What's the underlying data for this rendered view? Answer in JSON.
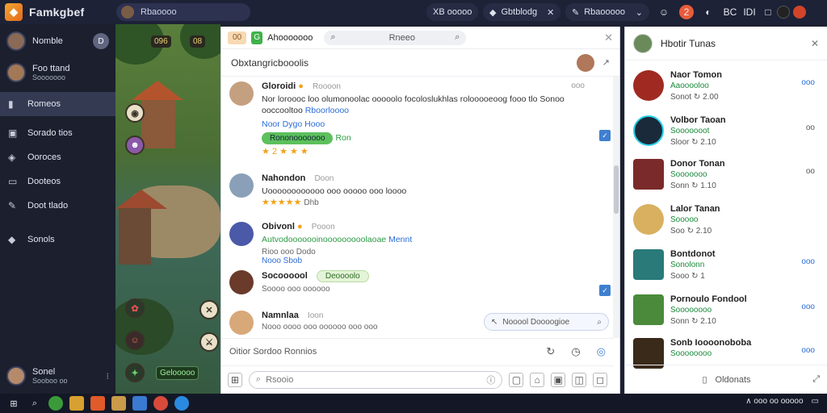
{
  "app": {
    "title": "Famkgbef",
    "logo_glyph": "◆"
  },
  "topbar": {
    "search_value": "Rbaoooo",
    "btn1": "XB ooooo",
    "btn2": "Gbtblodg",
    "btn3": "Rbaooooo",
    "icons": [
      "chat-icon",
      "notification-icon",
      "shield-icon",
      "friends-icon",
      "settings-icon"
    ],
    "notif_count": "2",
    "btn4": "BC",
    "btn5": "IDI"
  },
  "nav": {
    "profile": {
      "name": "Nomble",
      "badge": "D"
    },
    "account": {
      "name": "Foo ttand",
      "sub": "Sooooooo"
    },
    "items": [
      {
        "label": "Romeos",
        "icon": "home-icon",
        "selected": true
      },
      {
        "label": "Sorado tios",
        "icon": "grid-icon",
        "selected": false
      },
      {
        "label": "Ooroces",
        "icon": "tag-icon",
        "selected": false
      },
      {
        "label": "Dooteos",
        "icon": "folder-icon",
        "selected": false
      },
      {
        "label": "Doot tlado",
        "icon": "edit-icon",
        "selected": false
      },
      {
        "label": "Sonols",
        "icon": "diamond-icon",
        "selected": false
      }
    ],
    "user": {
      "name": "Sonel",
      "sub": "Sooboo oo"
    }
  },
  "game": {
    "hud_left": "096",
    "hud_right": "08",
    "bottom_label": "Gelooooo"
  },
  "chat": {
    "chip1": "00",
    "chip2": "G",
    "group_label": "Ahooooooo",
    "search_placeholder": "Rneeo",
    "title": "Obxtangricbooolis",
    "messages": [
      {
        "name": "Gloroidi",
        "time": "Roooon",
        "text": "Nor loroooc loo olumonoolac ooooolo focoloslukhlas rolooooeoog fooo tlo Sonoo ooccooltoo",
        "link": "Rboorloooo",
        "tag": "Noor Dygo Hooo",
        "pill": "Rononooooooo",
        "pill_note": "Ron",
        "stars": "★ 2 ★ ★ ★",
        "time_right": "ooo"
      },
      {
        "name": "Nahondon",
        "time": "Doon",
        "text": "Uoooooooooooo ooo ooooo ooo loooo",
        "stars": "★★★★★",
        "stars_note": "Dhb"
      },
      {
        "name": "Obivonl",
        "time": "Pooon",
        "text_green": "Autvodooooooinooooooooolaoae",
        "link": "Mennt",
        "react": "Rioo ooo Dodo"
      },
      {
        "name": "Socoooool",
        "pill": "Deoooolo",
        "react": "Soooo ooo oooooo"
      },
      {
        "name": "Namnlaa",
        "time": "Ioon",
        "react": "Nooo oooo ooo oooooo ooo ooo"
      }
    ],
    "reply_placeholder": "Nooool Doooogioe",
    "shown_text": "Oitior Sordoo Ronnios",
    "compose_placeholder": "Rsooio"
  },
  "friends": {
    "title": "Hbotir Tunas",
    "rows": [
      {
        "name": "Naor Tomon",
        "status": "Aaooooloo",
        "meta": "Sonot  ↻ 2.00",
        "right": "ooo"
      },
      {
        "name": "Volbor Taoan",
        "status": "Sooooooot",
        "meta": "Sloor  ↻ 2.10",
        "right": "oo"
      },
      {
        "name": "Donor Tonan",
        "status": "Sooooooo",
        "meta": "Sonn  ↻ 1.10",
        "right": "oo"
      },
      {
        "name": "Lalor Tanan",
        "status": "Sooooo",
        "meta": "Soo  ↻ 2.10",
        "right": ""
      },
      {
        "name": "Bontdonot",
        "status": "Sonolonn",
        "meta": "Sooo  ↻ 1",
        "right": "ooo"
      },
      {
        "name": "Pornoulo Fondool",
        "status": "Soooooooo",
        "meta": "Sonn  ↻ 2.10",
        "right": "ooo"
      },
      {
        "name": "Sonb Ioooonoboba",
        "status": "Soooooooo",
        "meta": "",
        "right": "ooo"
      }
    ],
    "footer": "Oldonats"
  },
  "taskbar": {
    "tray_text": "∧ ooo oo ooooo"
  }
}
